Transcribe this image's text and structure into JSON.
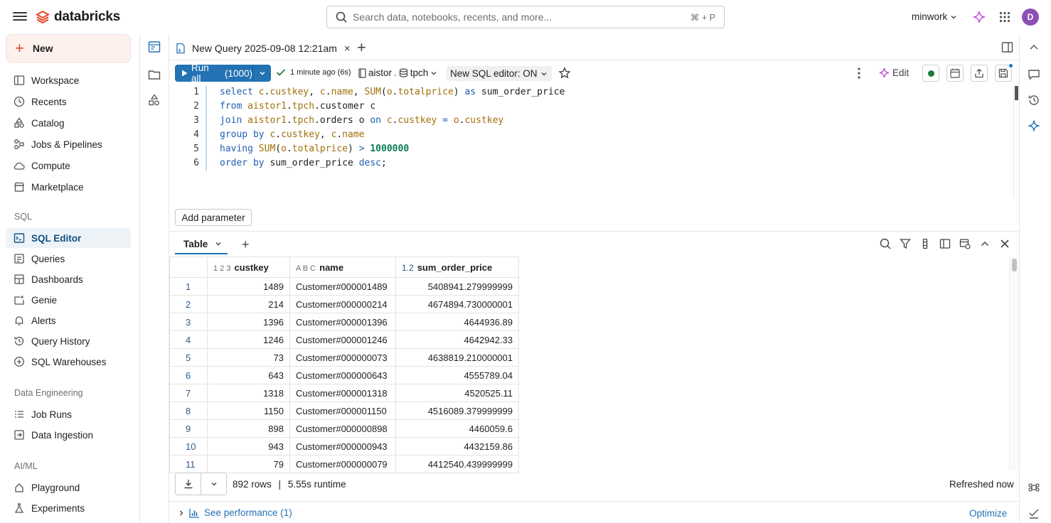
{
  "topbar": {
    "brand": "databricks",
    "search_placeholder": "Search data, notebooks, recents, and more...",
    "search_shortcut": "⌘ + P",
    "workspace": "minwork",
    "avatar_initial": "D"
  },
  "sidebar": {
    "new_label": "New",
    "items": [
      {
        "label": "Workspace",
        "icon": "workspace-icon"
      },
      {
        "label": "Recents",
        "icon": "clock-icon"
      },
      {
        "label": "Catalog",
        "icon": "catalog-icon"
      },
      {
        "label": "Jobs & Pipelines",
        "icon": "workflow-icon"
      },
      {
        "label": "Compute",
        "icon": "cloud-icon"
      },
      {
        "label": "Marketplace",
        "icon": "store-icon"
      }
    ],
    "sql_header": "SQL",
    "sql_items": [
      {
        "label": "SQL Editor",
        "icon": "sql-editor-icon",
        "active": true
      },
      {
        "label": "Queries",
        "icon": "query-icon"
      },
      {
        "label": "Dashboards",
        "icon": "dashboard-icon"
      },
      {
        "label": "Genie",
        "icon": "genie-icon"
      },
      {
        "label": "Alerts",
        "icon": "bell-icon"
      },
      {
        "label": "Query History",
        "icon": "history-icon"
      },
      {
        "label": "SQL Warehouses",
        "icon": "warehouse-icon"
      }
    ],
    "de_header": "Data Engineering",
    "de_items": [
      {
        "label": "Job Runs",
        "icon": "list-icon"
      },
      {
        "label": "Data Ingestion",
        "icon": "ingestion-icon"
      }
    ],
    "ai_header": "AI/ML",
    "ai_items": [
      {
        "label": "Playground",
        "icon": "playground-icon"
      },
      {
        "label": "Experiments",
        "icon": "experiment-icon"
      }
    ]
  },
  "tab": {
    "title": "New Query 2025-09-08 12:21am",
    "close": "×",
    "add": "+"
  },
  "toolbar": {
    "run_label": "Run all",
    "run_limit": "(1000)",
    "status": "1 minute ago (6s)",
    "catalog": "aistor",
    "schema": "tpch",
    "editor_toggle": "New SQL editor: ON",
    "edit_label": "Edit"
  },
  "editor": {
    "line_numbers": [
      "1",
      "2",
      "3",
      "4",
      "5",
      "6"
    ]
  },
  "add_parameter": "Add parameter",
  "results": {
    "tab_label": "Table",
    "add_tab": "+",
    "columns": [
      {
        "type": "1 2 3",
        "label": "custkey"
      },
      {
        "type": "A B C",
        "label": "name"
      },
      {
        "type": "1.2",
        "label": "sum_order_price"
      }
    ],
    "rows": [
      [
        "1",
        "1489",
        "Customer#000001489",
        "5408941.279999999"
      ],
      [
        "2",
        "214",
        "Customer#000000214",
        "4674894.730000001"
      ],
      [
        "3",
        "1396",
        "Customer#000001396",
        "4644936.89"
      ],
      [
        "4",
        "1246",
        "Customer#000001246",
        "4642942.33"
      ],
      [
        "5",
        "73",
        "Customer#000000073",
        "4638819.210000001"
      ],
      [
        "6",
        "643",
        "Customer#000000643",
        "4555789.04"
      ],
      [
        "7",
        "1318",
        "Customer#000001318",
        "4520525.11"
      ],
      [
        "8",
        "1150",
        "Customer#000001150",
        "4516089.379999999"
      ],
      [
        "9",
        "898",
        "Customer#000000898",
        "4460059.6"
      ],
      [
        "10",
        "943",
        "Customer#000000943",
        "4432159.86"
      ],
      [
        "11",
        "79",
        "Customer#000000079",
        "4412540.439999999"
      ]
    ],
    "row_count": "892 rows",
    "separator": "|",
    "runtime": "5.55s runtime",
    "refreshed": "Refreshed now",
    "see_performance": "See performance (1)",
    "optimize": "Optimize"
  },
  "colors": {
    "accent": "#2272b4",
    "brand": "#e5452a",
    "active_nav_bg": "#eef3f8"
  }
}
